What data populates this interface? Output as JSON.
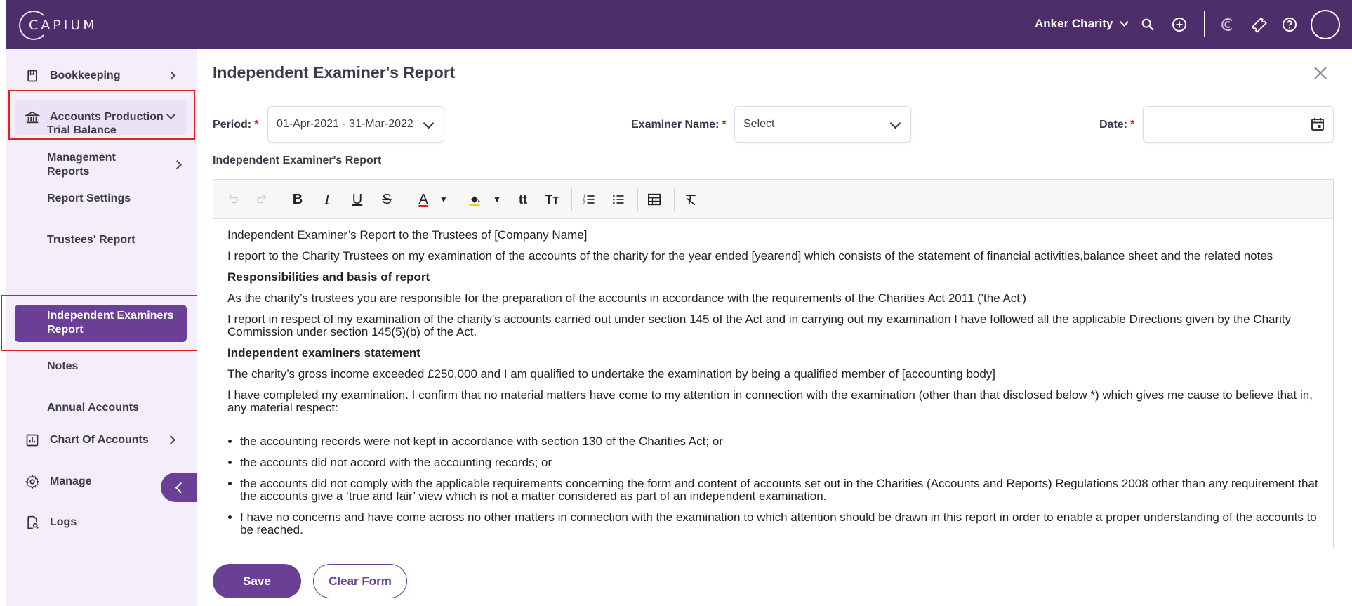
{
  "app": {
    "logo_text": "CAPIUM"
  },
  "header": {
    "org_name": "Anker Charity",
    "icons": [
      "search-icon",
      "add-circle-icon",
      "capium-c-icon",
      "ticket-icon",
      "help-icon",
      "user-avatar"
    ]
  },
  "sidebar": {
    "items": [
      {
        "label": "Bookkeeping",
        "icon": "book-icon"
      },
      {
        "label": "Accounts Production",
        "icon": "bank-icon"
      },
      {
        "label": "Chart Of Accounts",
        "icon": "bar-chart-icon"
      },
      {
        "label": "Manage",
        "icon": "gear-icon"
      },
      {
        "label": "Logs",
        "icon": "document-search-icon"
      }
    ],
    "sub_items": [
      {
        "label": "Trial Balance"
      },
      {
        "label": "Management Reports"
      },
      {
        "label": "Report Settings"
      },
      {
        "label": "Trustees' Report"
      },
      {
        "label": "Independent Examiners Report"
      },
      {
        "label": "Notes"
      },
      {
        "label": "Annual Accounts"
      }
    ]
  },
  "page": {
    "title": "Independent Examiner's Report",
    "period_label": "Period:",
    "period_value": "01-Apr-2021 - 31-Mar-2022",
    "examiner_label": "Examiner Name:",
    "examiner_placeholder": "Select",
    "date_label": "Date:",
    "date_value": "",
    "required_mark": "*",
    "section_label": "Independent Examiner's Report"
  },
  "editor": {
    "toolbar": [
      "undo",
      "redo",
      "bold",
      "italic",
      "underline",
      "strikethrough",
      "font-color",
      "highlight-color",
      "font-size",
      "text-size",
      "numbered-list",
      "bulleted-list",
      "table",
      "clear-format"
    ],
    "paragraphs": [
      {
        "text": "Independent Examiner’s Report to the Trustees of [Company Name]",
        "bold": false
      },
      {
        "text": "I report to the Charity Trustees on my examination of the accounts of the charity for the year ended [yearend] which consists of the statement of financial activities,balance sheet and the related notes",
        "bold": false
      },
      {
        "text": "Responsibilities and basis of report",
        "bold": true
      },
      {
        "text": "As the charity’s trustees you are responsible for the preparation of the accounts in accordance with the requirements of the Charities Act 2011 ('the Act')",
        "bold": false
      },
      {
        "text": "I report in respect of my examination of the charity's accounts carried out under section 145 of the Act and in carrying out my examination I have followed all the applicable Directions given by the Charity Commission under section 145(5)(b) of the Act.",
        "bold": false
      },
      {
        "text": "Independent examiners statement",
        "bold": true
      },
      {
        "text": "The charity’s gross income exceeded £250,000 and I am qualified to undertake the examination by being a qualified member of [accounting body]",
        "bold": false
      },
      {
        "text": "I have completed my examination. I confirm that no material matters have come to my attention in connection with the examination (other than that disclosed below *) which gives me cause to believe that in, any material respect:",
        "bold": false
      }
    ],
    "bullets": [
      "the accounting records were not kept in accordance with section 130 of the Charities Act; or",
      "the accounts did not accord with the accounting records; or",
      "the accounts did not comply with the applicable requirements concerning the form and content of accounts set out in the Charities (Accounts and Reports) Regulations 2008 other than any requirement that the accounts give a ‘true and fair’ view which is not a matter considered as part of an independent examination.",
      "I have no concerns and have come across no other matters in connection with the examination to which attention should be drawn in this report in order to enable a proper understanding of the accounts to be reached."
    ]
  },
  "footer": {
    "save_label": "Save",
    "clear_label": "Clear Form"
  },
  "colors": {
    "brand": "#4e2d6b",
    "accent": "#6c3f97",
    "sidebar_bg": "#f3eef9",
    "required": "#d32f2f",
    "highlight_box": "#e02020"
  }
}
